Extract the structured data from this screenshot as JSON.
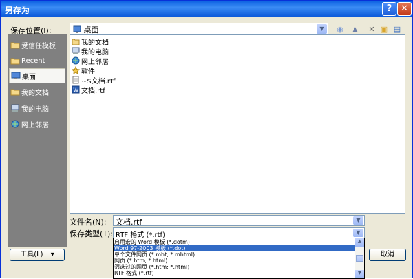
{
  "window": {
    "title": "另存为",
    "help_glyph": "?",
    "close_glyph": "✕"
  },
  "save_location": {
    "label": "保存位置(I):",
    "value": "桌面"
  },
  "toolbar": {
    "back_glyph": "◉",
    "up_glyph": "▲",
    "delete_glyph": "✕",
    "new_folder_glyph": "▣",
    "views_glyph": "▤"
  },
  "places": [
    {
      "label": "受信任模板",
      "icon": "folder-icon",
      "selected": false
    },
    {
      "label": "Recent",
      "icon": "folder-icon",
      "selected": false
    },
    {
      "label": "桌面",
      "icon": "desktop-icon",
      "selected": true
    },
    {
      "label": "我的文档",
      "icon": "folder-icon",
      "selected": false
    },
    {
      "label": "我的电脑",
      "icon": "computer-icon",
      "selected": false
    },
    {
      "label": "网上邻居",
      "icon": "network-icon",
      "selected": false
    }
  ],
  "files": [
    {
      "name": "我的文档",
      "icon": "folder-icon"
    },
    {
      "name": "我的电脑",
      "icon": "computer-icon"
    },
    {
      "name": "网上邻居",
      "icon": "network-icon"
    },
    {
      "name": "软件",
      "icon": "shortcut-icon"
    },
    {
      "name": "~$文档.rtf",
      "icon": "document-icon"
    },
    {
      "name": "文档.rtf",
      "icon": "document-icon"
    }
  ],
  "filename": {
    "label": "文件名(N):",
    "value": "文档.rtf"
  },
  "filetype": {
    "label": "保存类型(T):",
    "value": "RTF 格式 (*.rtf)",
    "options": [
      "启用宏的 Word 模板 (*.dotm)",
      "Word 97-2003 模板 (*.dot)",
      "单个文件网页 (*.mht; *.mhtml)",
      "网页 (*.htm; *.html)",
      "筛选过的网页 (*.htm; *.html)",
      "RTF 格式 (*.rtf)"
    ],
    "selected_index": 1
  },
  "buttons": {
    "tools": "工具(L)",
    "tools_arrow": "▾",
    "cancel": "取消"
  }
}
